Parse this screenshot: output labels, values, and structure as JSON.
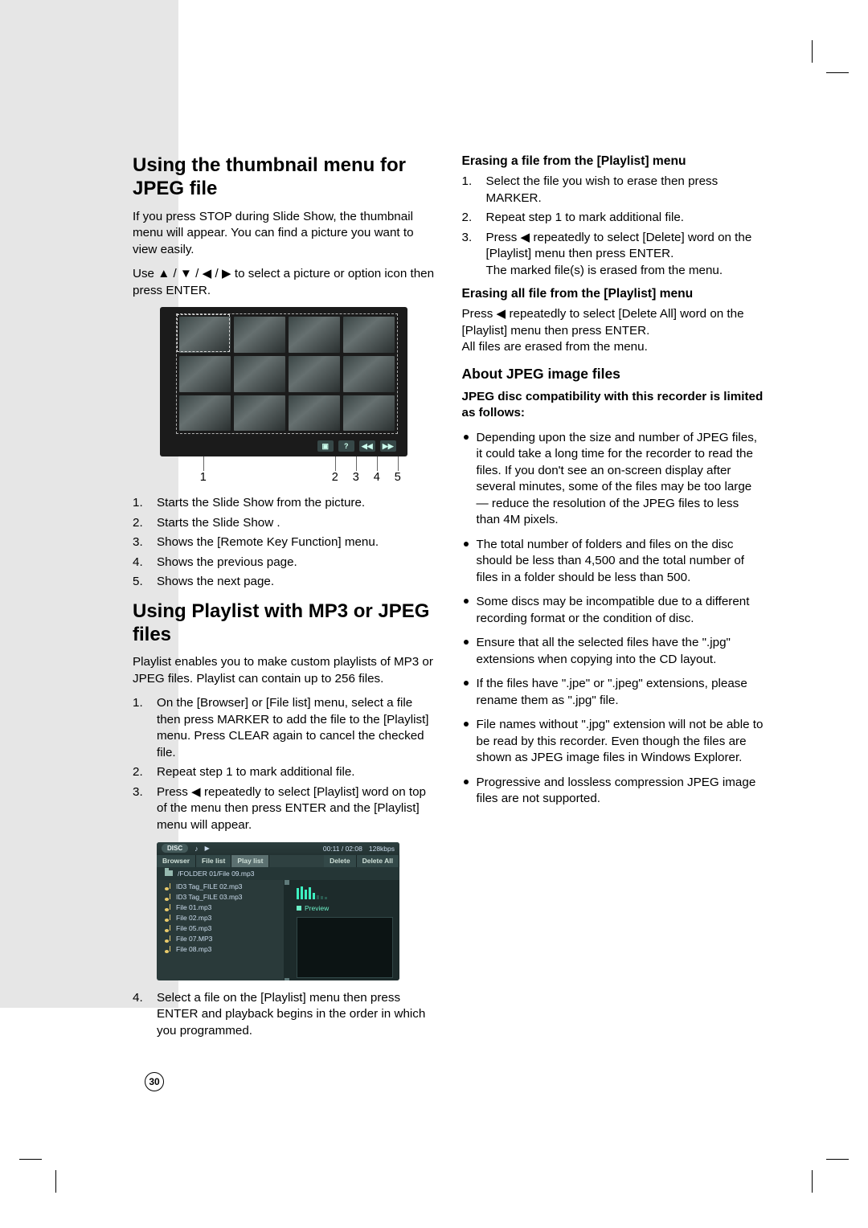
{
  "page_number": "30",
  "left": {
    "h1a": "Using the thumbnail menu for JPEG file",
    "intro1": "If you press STOP during Slide Show, the thumbnail menu will appear. You can find a picture you want to view easily.",
    "intro2_pre": "Use ",
    "intro2_arrows": "▲ / ▼ / ◀ / ▶",
    "intro2_post": " to select a picture or option icon then press ENTER.",
    "thumb_callouts": [
      "1",
      "2",
      "3",
      "4",
      "5"
    ],
    "thumb_list": [
      "Starts the Slide Show from the picture.",
      "Starts the Slide Show .",
      "Shows the [Remote Key Function] menu.",
      "Shows the previous page.",
      "Shows the next page."
    ],
    "h1b": "Using Playlist with MP3 or JPEG files",
    "pl_intro": "Playlist enables you to make custom playlists of MP3 or JPEG files. Playlist can contain up to 256 files.",
    "pl_steps_13": [
      "On the [Browser] or [File list] menu, select a file then press MARKER to add the file to the [Playlist] menu. Press CLEAR again to cancel the checked file.",
      "Repeat step 1 to mark additional file.",
      "Press ◀ repeatedly to select [Playlist] word on top of the menu then press ENTER and the [Playlist] menu will appear."
    ],
    "pl_step4": "Select a file on the [Playlist] menu then press ENTER and playback begins in the order in which you programmed.",
    "pl_fig": {
      "disc": "DISC",
      "time": "00:11 / 02:08",
      "rate": "128kbps",
      "tabs": [
        "Browser",
        "File list",
        "Play list"
      ],
      "right_tabs": [
        "Delete",
        "Delete All"
      ],
      "path": "/FOLDER 01/File 09.mp3",
      "files": [
        "ID3 Tag_FILE 02.mp3",
        "ID3 Tag_FILE 03.mp3",
        "File 01.mp3",
        "File 02.mp3",
        "File 05.mp3",
        "File 07.MP3",
        "File 08.mp3"
      ],
      "preview": "Preview"
    }
  },
  "right": {
    "h3a": "Erasing a file from the [Playlist] menu",
    "erase_one": [
      "Select the file you wish to erase then press MARKER.",
      "Repeat step 1 to mark additional file.",
      "Press ◀ repeatedly to select [Delete] word on the [Playlist] menu then press ENTER.\nThe marked file(s) is erased from the menu."
    ],
    "h3b": "Erasing all file from the [Playlist] menu",
    "erase_all": "Press ◀ repeatedly to select [Delete All] word on the [Playlist] menu then press ENTER.\nAll files are erased from the menu.",
    "h2": "About JPEG image files",
    "compat_head": "JPEG disc compatibility with this recorder is limited as follows:",
    "bullets": [
      "Depending upon the size and number of JPEG files, it could take a long time for the recorder to read the files. If you don't see an on-screen display after several minutes, some of the files may be too large — reduce the resolution of the JPEG files to less than 4M pixels.",
      "The total number of folders and files on the disc should be less than 4,500 and the total number of files in a folder should be less than 500.",
      "Some discs may be incompatible due to a different recording format or the condition of disc.",
      "Ensure that all the selected files have the \".jpg\" extensions when copying into the CD layout.",
      "If the files have \".jpe\" or \".jpeg\" extensions, please rename them as \".jpg\" file.",
      "File names without \".jpg\" extension will not be able to be read by this recorder. Even though the files are shown as JPEG image files in Windows Explorer.",
      "Progressive and lossless compression JPEG image files are not supported."
    ]
  }
}
